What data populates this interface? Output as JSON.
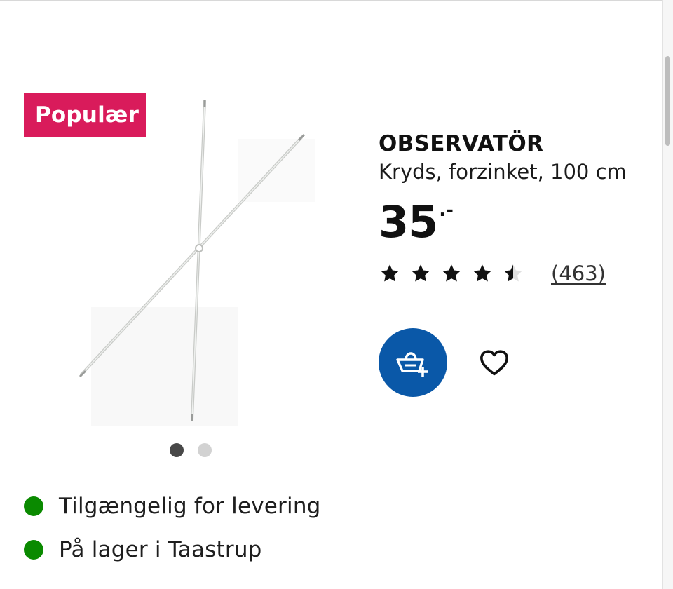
{
  "badge": {
    "label": "Populær"
  },
  "product": {
    "name": "OBSERVATÖR",
    "description": "Kryds, forzinket, 100 cm",
    "price": {
      "amount": "35",
      "suffix": ".-"
    },
    "rating": {
      "stars": 4.5,
      "max": 5,
      "review_count": "(463)"
    },
    "image": {
      "icon": "cross-bars-product-image"
    }
  },
  "gallery": {
    "current": 1,
    "total": 2
  },
  "actions": {
    "cart_icon": "add-to-cart-icon",
    "favorite_icon": "heart-icon"
  },
  "availability": [
    {
      "text": "Tilgængelig for levering",
      "status": "available"
    },
    {
      "text": "På lager i Taastrup",
      "status": "available"
    }
  ],
  "colors": {
    "badge": "#d91b5b",
    "cart_button": "#0a58a8",
    "available": "#0a8a00",
    "star": "#111111"
  }
}
